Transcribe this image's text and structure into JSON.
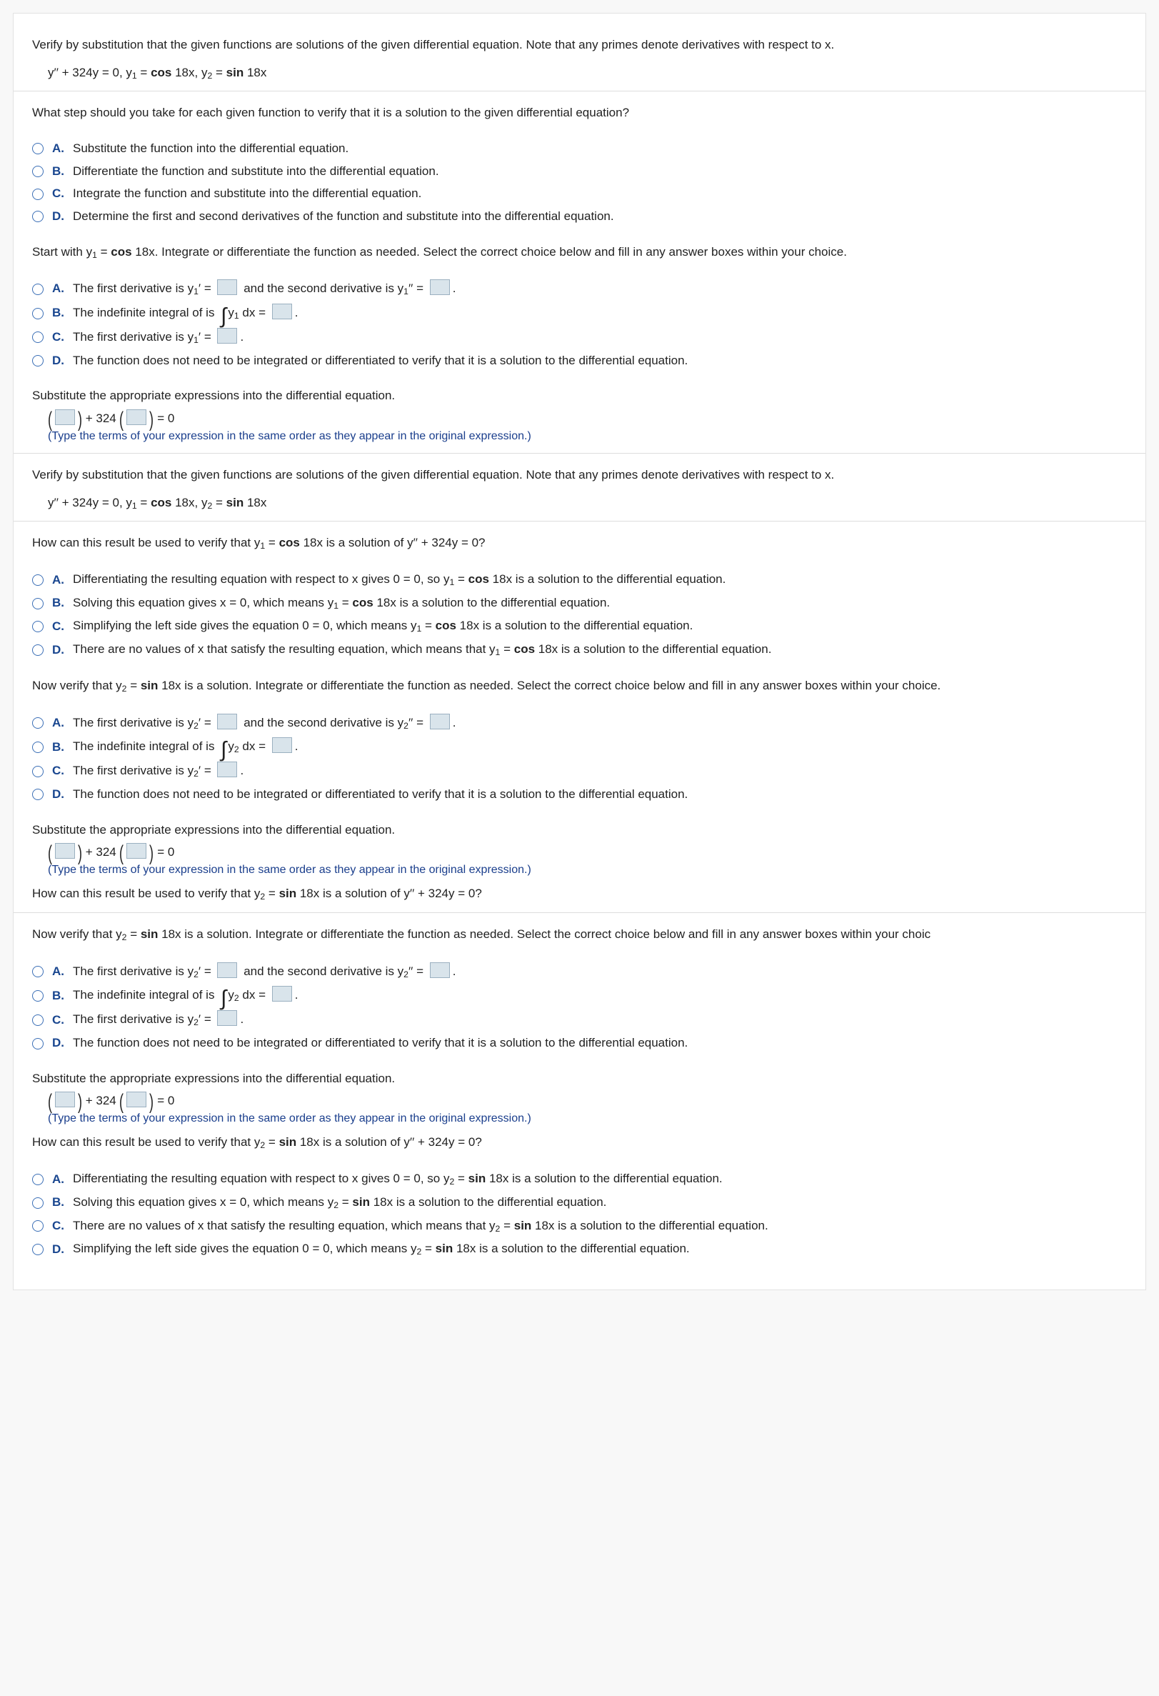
{
  "intro": "Verify by substitution that the given functions are solutions of the given differential equation. Note that any primes denote derivatives with respect to x.",
  "eq_prefix": "y′′ + 324y = 0, y",
  "eq_mid1": " = ",
  "cos": "cos",
  "eq_arg": " 18x, y",
  "sin": "sin",
  "eq_arg2": " 18x",
  "q1": "What step should you take for each given function to verify that it is a solution to the given differential equation?",
  "labels": {
    "A": "A.",
    "B": "B.",
    "C": "C.",
    "D": "D."
  },
  "q1opts": {
    "A": "Substitute the function into the differential equation.",
    "B": "Differentiate the function and substitute into the differential equation.",
    "C": "Integrate the function and substitute into the differential equation.",
    "D": "Determine the first and second derivatives of the function and substitute into the differential equation."
  },
  "start1": "Start with y",
  "start1b": " = ",
  "start1c": " 18x. Integrate or differentiate the function as needed. Select the correct choice below and fill in any answer boxes within your choice.",
  "dA_p1": "The first derivative is y",
  "dA_p2": "′ = ",
  "dA_p3": " and the second derivative is y",
  "dA_p4": "′′ = ",
  "dot": ".",
  "dB_p1": "The indefinite integral of is ",
  "dB_p2": " dx = ",
  "dC_p1": "The first derivative is y",
  "dC_p2": "′ = ",
  "dD": "The function does not need to be integrated or differentiated to verify that it is a solution to the differential equation.",
  "sub_prompt": "Substitute the appropriate expressions into the differential equation.",
  "sub_mid": " + 324 ",
  "sub_eq": " = 0",
  "sub_hint": "(Type the terms of your expression in the same order as they appear in the original expression.)",
  "verify_q_p1": "How can this result be used to verify that y",
  "verify_q_p2": " = ",
  "verify_q_p3": " 18x is a solution of y′′ + 324y = 0?",
  "vA_p1": "Differentiating the resulting equation with respect to x gives 0 = 0, so y",
  "vA_p3": " 18x is a solution to the differential equation.",
  "vB_p1": "Solving this equation gives x = 0, which means y",
  "vB_p3": " 18x is a solution to the differential equation.",
  "vC_p1": "Simplifying the left side gives the equation 0 = 0, which means y",
  "vC_p3": " 18x is a solution to the differential equation.",
  "vD_p1": "There are no values of x that satisfy the resulting equation, which means that y",
  "vD_p3": " 18x is a solution to the differential equation.",
  "now_p1": "Now verify that y",
  "now_p2": " = ",
  "now_p3": " 18x is a solution. Integrate or differentiate the function as needed. Select the correct choice below and fill in any answer boxes within your choic",
  "now_p3_full": " 18x is a solution. Integrate or differentiate the function as needed. Select the correct choice below and fill in any answer boxes within your choice.",
  "y1sub": "1",
  "y2sub": "2"
}
